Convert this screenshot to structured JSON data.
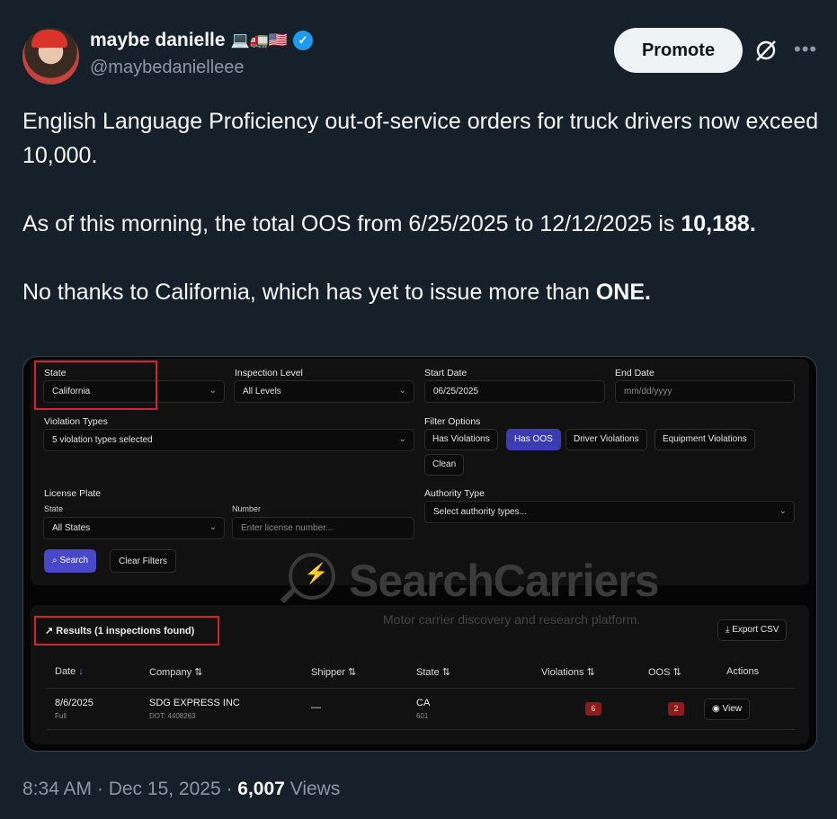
{
  "author": {
    "display_name": "maybe danielle",
    "emoji": "💻🚛🇺🇸",
    "handle": "@maybedanielleee",
    "verified_color": "#1d9bf0"
  },
  "header": {
    "promote_label": "Promote",
    "grok_icon": "slash-circle-icon",
    "more_icon": "more-icon"
  },
  "tweet": {
    "para1": "English Language Proficiency out-of-service orders for truck drivers now exceed 10,000.",
    "para2_prefix": "As of this morning, the total OOS from 6/25/2025 to 12/12/2025 is ",
    "para2_bold": "10,188.",
    "para3_prefix": "No thanks to California, which has yet to issue more than ",
    "para3_bold": "ONE."
  },
  "screenshot": {
    "state_label": "State",
    "state_value": "California",
    "inspection_label": "Inspection Level",
    "inspection_value": "All Levels",
    "start_label": "Start Date",
    "start_value": "06/25/2025",
    "end_label": "End Date",
    "end_placeholder": "mm/dd/yyyy",
    "violation_label": "Violation Types",
    "violation_value": "5 violation types selected",
    "filter_label": "Filter Options",
    "filters": [
      "Has Violations",
      "Has OOS",
      "Driver Violations",
      "Equipment Violations",
      "Clean"
    ],
    "plate_label": "License Plate",
    "plate_state_label": "State",
    "plate_state_value": "All States",
    "plate_number_label": "Number",
    "plate_number_placeholder": "Enter license number...",
    "authority_label": "Authority Type",
    "authority_value": "Select authority types...",
    "search_label": "Search",
    "clear_label": "Clear Filters",
    "watermark_title": "SearchCarriers",
    "watermark_tag": "Motor carrier discovery and research platform.",
    "results_label": "Results (1 inspections found)",
    "export_label": "Export CSV",
    "columns": [
      "Date",
      "Company",
      "Shipper",
      "State",
      "Violations",
      "OOS",
      "Actions"
    ],
    "row": {
      "date": "8/6/2025",
      "level": "Full",
      "company": "SDG EXPRESS INC",
      "dot": "DOT: 4408263",
      "shipper": "—",
      "state": "CA",
      "state_sub": "601",
      "violations": "6",
      "oos": "2",
      "action": "View"
    },
    "highlight_color": "#d2262c",
    "accent_color": "#4848c8"
  },
  "meta": {
    "time": "8:34 AM · Dec 15, 2025 · ",
    "views_count": "6,007",
    "views_label": " Views"
  }
}
